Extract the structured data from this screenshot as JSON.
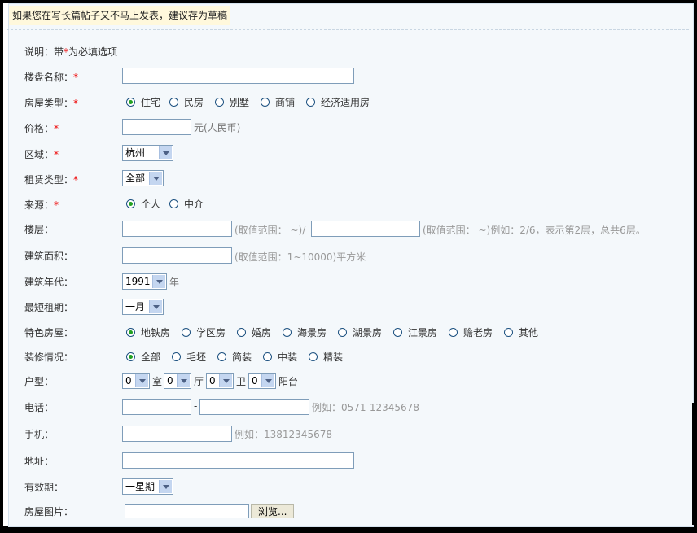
{
  "tip": "如果您在写长篇帖子又不马上发表，建议存为草稿",
  "note": {
    "prefix": "说明：带",
    "star": "*",
    "suffix": "为必填选项"
  },
  "fields": {
    "name_label": "楼盘名称：",
    "house_type_label": "房屋类型：",
    "house_types": [
      "住宅",
      "民房",
      "别墅",
      "商铺",
      "经济适用房"
    ],
    "price_label": "价格：",
    "price_unit": "元(人民币)",
    "region_label": "区域：",
    "region_value": "杭州",
    "rent_type_label": "租赁类型：",
    "rent_type_value": "全部",
    "source_label": "来源：",
    "sources": [
      "个人",
      "中介"
    ],
    "floor_label": "楼层：",
    "floor_hint1": "(取值范围：  ~)/",
    "floor_hint2": "(取值范围：  ~)例如：2/6，表示第2层，总共6层。",
    "area_label": "建筑面积：",
    "area_hint": "(取值范围：1~10000)平方米",
    "year_label": "建筑年代：",
    "year_value": "1991",
    "year_unit": "年",
    "min_rent_label": "最短租期：",
    "min_rent_value": "一月",
    "feature_label": "特色房屋：",
    "features": [
      "地铁房",
      "学区房",
      "婚房",
      "海景房",
      "湖景房",
      "江景房",
      "赡老房",
      "其他"
    ],
    "decor_label": "装修情况：",
    "decors": [
      "全部",
      "毛坯",
      "简装",
      "中装",
      "精装"
    ],
    "layout_label": "户型：",
    "layout_values": [
      "0",
      "0",
      "0",
      "0"
    ],
    "layout_units": [
      "室",
      "厅",
      "卫",
      "阳台"
    ],
    "phone_label": "电话：",
    "phone_sep": "-",
    "phone_hint": "例如：0571-12345678",
    "mobile_label": "手机：",
    "mobile_hint": "例如：13812345678",
    "address_label": "地址：",
    "valid_label": "有效期：",
    "valid_value": "一星期",
    "photo_label": "房屋图片：",
    "browse_label": "浏览..."
  },
  "colors": {
    "required": "#ee0000",
    "radio_on": "#21a121",
    "panel": "#f4f8fb",
    "tip_bg": "#fff8dc"
  }
}
